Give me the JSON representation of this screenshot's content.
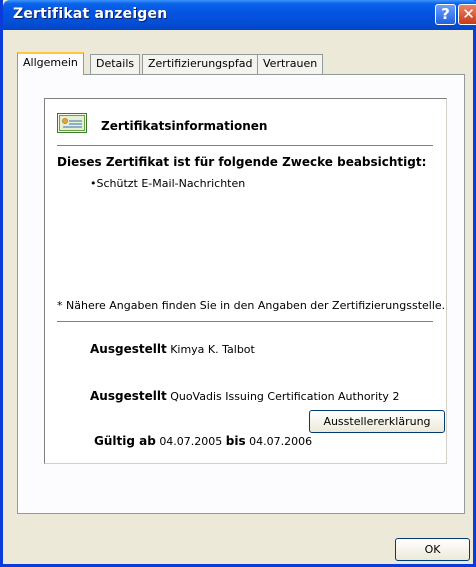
{
  "window": {
    "title": "Zertifikat anzeigen",
    "help_glyph": "?",
    "close_glyph": "✕"
  },
  "tabs": [
    {
      "label": "Allgemein",
      "active": true
    },
    {
      "label": "Details",
      "active": false
    },
    {
      "label": "Zertifizierungspfad",
      "active": false
    },
    {
      "label": "Vertrauen",
      "active": false
    }
  ],
  "info": {
    "heading": "Zertifikatsinformationen",
    "icon": "certificate-icon",
    "purpose_heading": "Dieses Zertifikat ist für folgende Zwecke beabsichtigt:",
    "purposes": [
      "•Schützt E-Mail-Nachrichten"
    ],
    "note": "* Nähere Angaben finden Sie in den Angaben der Zertifizierungsstelle.",
    "issued_to_label": "Ausgestellt",
    "issued_to_value": "Kimya K. Talbot",
    "issued_by_label": "Ausgestellt",
    "issued_by_value": "QuoVadis Issuing Certification Authority 2",
    "valid_from_label": "Gültig ab",
    "valid_from_value": "04.07.2005",
    "valid_to_label": "bis",
    "valid_to_value": "04.07.2006"
  },
  "buttons": {
    "issuer_statement": "Ausstellererklärung",
    "ok": "OK"
  },
  "colors": {
    "titlebar": "#0554e3",
    "dialog_bg": "#ece9d8",
    "tab_highlight": "#ffc83c"
  }
}
